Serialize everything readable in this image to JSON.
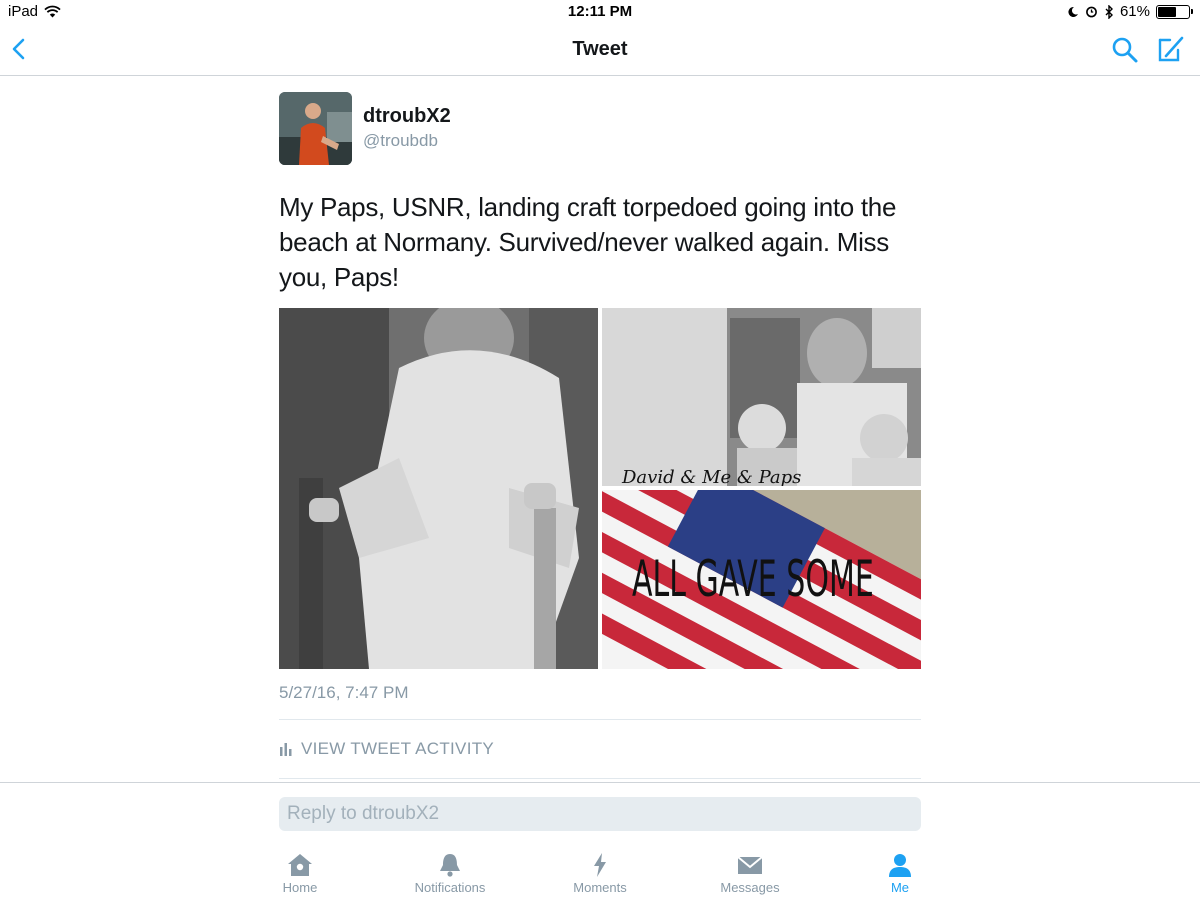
{
  "status_bar": {
    "device": "iPad",
    "time": "12:11 PM",
    "battery_percent": "61%",
    "battery_level": 0.61
  },
  "nav": {
    "title": "Tweet"
  },
  "tweet": {
    "display_name": "dtroubX2",
    "screen_name": "@troubdb",
    "text": "My Paps, USNR, landing craft torpedoed going into the beach at Normany. Survived/never walked again. Miss you, Paps!",
    "photo_2_caption": "David & Me & Paps",
    "photo_3_caption": "ALL GAVE SOME",
    "timestamp": "5/27/16, 7:47 PM",
    "activity_label": "VIEW TWEET ACTIVITY"
  },
  "reply": {
    "placeholder": "Reply to dtroubX2"
  },
  "tabs": [
    {
      "label": "Home",
      "icon": "home-icon"
    },
    {
      "label": "Notifications",
      "icon": "bell-icon"
    },
    {
      "label": "Moments",
      "icon": "lightning-icon"
    },
    {
      "label": "Messages",
      "icon": "envelope-icon"
    },
    {
      "label": "Me",
      "icon": "person-icon",
      "active": true
    }
  ],
  "colors": {
    "accent": "#1da1f2",
    "secondary_text": "#8899a6",
    "primary_text": "#14171a"
  }
}
